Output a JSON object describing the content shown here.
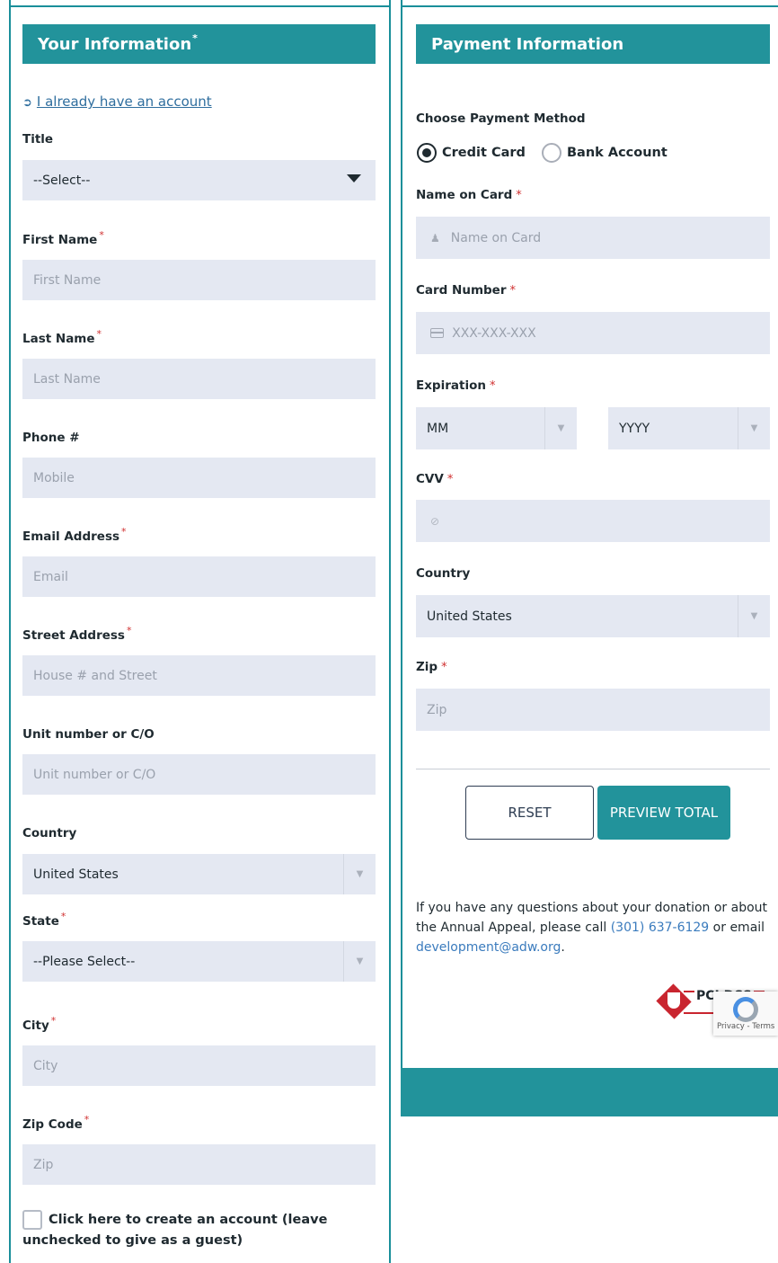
{
  "left": {
    "header": {
      "title": "Your Information",
      "mark": "*"
    },
    "account_link": "I already have an account",
    "title_field": {
      "label": "Title",
      "value": "--Select--"
    },
    "first_name": {
      "label": "First Name",
      "placeholder": "First Name"
    },
    "last_name": {
      "label": "Last Name",
      "placeholder": "Last Name"
    },
    "phone": {
      "label": "Phone #",
      "placeholder": "Mobile"
    },
    "email": {
      "label": "Email Address",
      "placeholder": "Email"
    },
    "street": {
      "label": "Street Address",
      "placeholder": "House # and Street"
    },
    "unit": {
      "label": "Unit number or C/O",
      "placeholder": "Unit number or C/O"
    },
    "country": {
      "label": "Country",
      "value": "United States"
    },
    "state": {
      "label": "State",
      "value": "--Please Select--"
    },
    "city": {
      "label": "City",
      "placeholder": "City"
    },
    "zip": {
      "label": "Zip Code",
      "placeholder": "Zip"
    },
    "create_account": {
      "line1": "Click here to create an account (leave",
      "line2": "unchecked to give as a guest)"
    }
  },
  "right": {
    "header": {
      "title": "Payment Information"
    },
    "method_label": "Choose Payment Method",
    "methods": {
      "credit": "Credit Card",
      "bank": "Bank Account"
    },
    "name_on_card": {
      "label": "Name on Card",
      "placeholder": "Name on Card"
    },
    "card_number": {
      "label": "Card Number",
      "placeholder": "XXX-XXX-XXX"
    },
    "expiration": {
      "label": "Expiration",
      "month": "MM",
      "year": "YYYY"
    },
    "cvv": {
      "label": "CVV"
    },
    "country": {
      "label": "Country",
      "value": "United States"
    },
    "zip": {
      "label": "Zip",
      "placeholder": "Zip"
    },
    "buttons": {
      "reset": "RESET",
      "preview": "PREVIEW TOTAL"
    },
    "info": {
      "p1": "If you have any questions about your donation or about the Annual Appeal, please call ",
      "phone": "(301) 637-6129",
      "p2": " or email ",
      "email": "development@adw.org",
      "p3": "."
    },
    "pci_badge": "PCI DSS",
    "recaptcha": "Privacy - Terms"
  },
  "required_mark": "*",
  "colors": {
    "accent": "#22939b",
    "field_bg": "#e4e8f2",
    "required": "#d03030",
    "link": "#2f6e9e"
  }
}
